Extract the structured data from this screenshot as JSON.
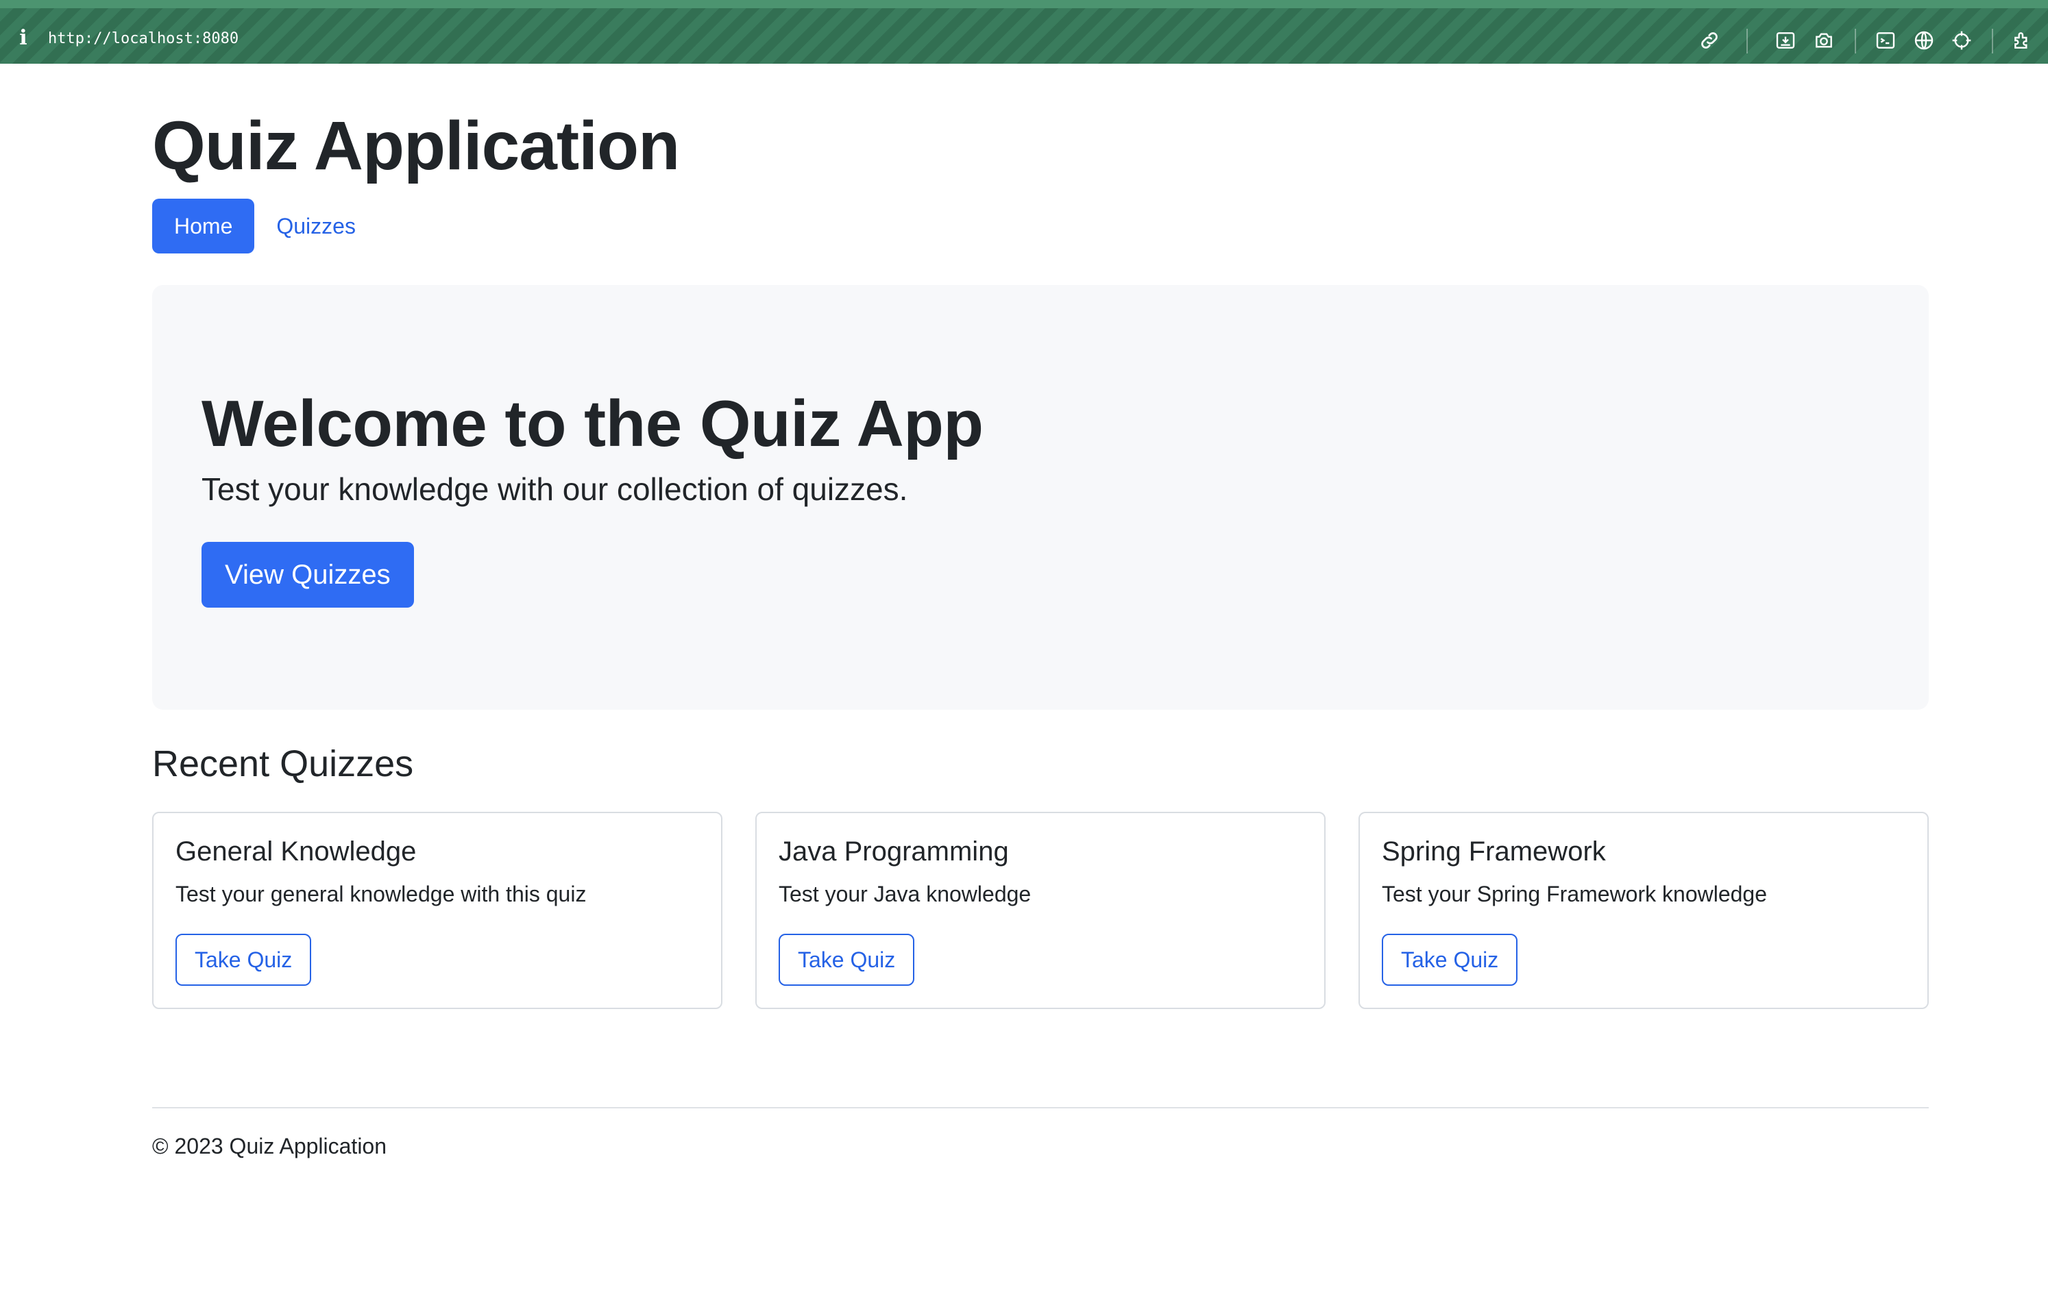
{
  "browser": {
    "url": "http://localhost:8080",
    "toolbar_icons": [
      "link-icon",
      "save-screenshot-icon",
      "camera-icon",
      "terminal-icon",
      "globe-icon",
      "crosshair-icon",
      "extensions-icon"
    ]
  },
  "header": {
    "app_title": "Quiz Application",
    "nav": [
      {
        "label": "Home",
        "active": true
      },
      {
        "label": "Quizzes",
        "active": false
      }
    ]
  },
  "hero": {
    "title": "Welcome to the Quiz App",
    "lead": "Test your knowledge with our collection of quizzes.",
    "button_label": "View Quizzes"
  },
  "recent": {
    "section_title": "Recent Quizzes",
    "quizzes": [
      {
        "title": "General Knowledge",
        "description": "Test your general knowledge with this quiz",
        "button_label": "Take Quiz"
      },
      {
        "title": "Java Programming",
        "description": "Test your Java knowledge",
        "button_label": "Take Quiz"
      },
      {
        "title": "Spring Framework",
        "description": "Test your Spring Framework knowledge",
        "button_label": "Take Quiz"
      }
    ]
  },
  "footer": {
    "text": "© 2023 Quiz Application"
  },
  "colors": {
    "primary": "#2f6cf3",
    "link": "#2562e6",
    "hero_bg": "#f7f8fa",
    "toolbar_bg": "#3a7c5d",
    "text": "#212529"
  }
}
